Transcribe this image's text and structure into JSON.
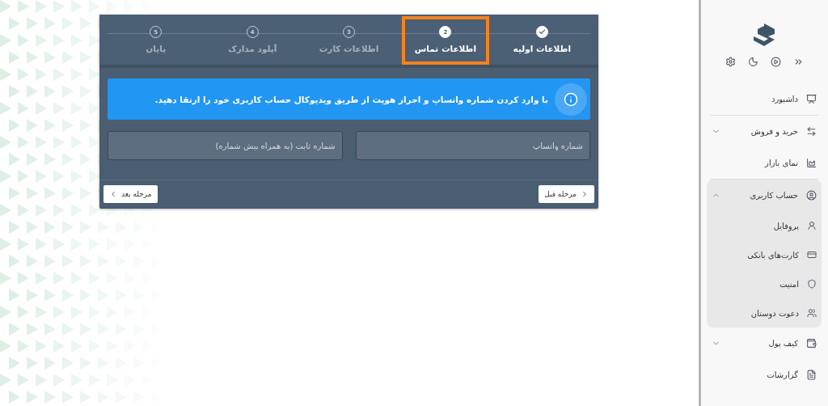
{
  "steps": [
    {
      "label": "اطلاعات اولیه",
      "done": true,
      "selected": false
    },
    {
      "number": "2",
      "label": "اطلاعات تماس",
      "done": false,
      "selected": true
    },
    {
      "number": "3",
      "label": "اطلاعات کارت",
      "done": false,
      "selected": false
    },
    {
      "number": "4",
      "label": "آپلود مدارک",
      "done": false,
      "selected": false
    },
    {
      "number": "5",
      "label": "پایان",
      "done": false,
      "selected": false
    }
  ],
  "alert": {
    "text": "با وارد کردن شماره واتساپ و احراز هویت از طریق ویدیوکال حساب کاربری خود را ارتقا دهید."
  },
  "fields": [
    {
      "placeholder": "شماره واتساپ"
    },
    {
      "placeholder": "شماره ثابت (به همراه پیش شماره)"
    }
  ],
  "buttons": {
    "previous": "مرحله قبل",
    "next": "مرحله بعد"
  },
  "sidebar": {
    "items": [
      {
        "label": "داشبورد",
        "divider": true
      },
      {
        "label": "خرید و فروش",
        "expanded": false,
        "divider": false
      },
      {
        "label": "نمای بازار",
        "divider": true
      },
      {
        "label": "حساب کاربری",
        "expanded": true,
        "divider": false,
        "children": [
          {
            "label": "پروفایل"
          },
          {
            "label": "کارت‌های بانکی"
          },
          {
            "label": "امنیت"
          },
          {
            "label": "دعوت دوستان"
          }
        ]
      },
      {
        "label": "کیف پول",
        "expanded": false,
        "divider": false
      },
      {
        "label": "گزارشات",
        "divider": false
      }
    ]
  }
}
